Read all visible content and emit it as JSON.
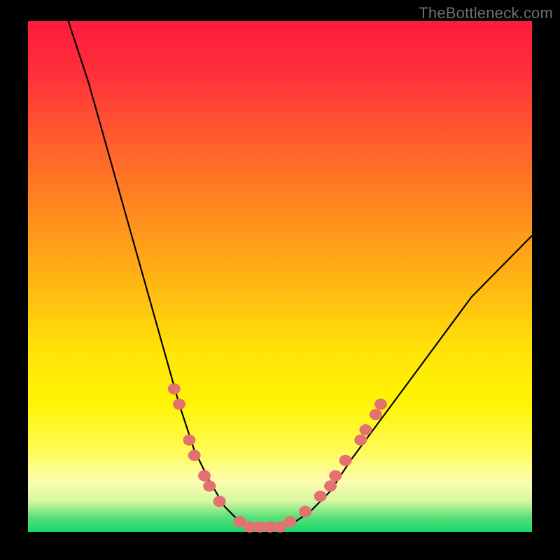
{
  "watermark": "TheBottleneck.com",
  "colors": {
    "background": "#000000",
    "curve": "#000000",
    "marker_fill": "#e4716f",
    "marker_stroke": "#c9574f"
  },
  "chart_data": {
    "type": "line",
    "title": "",
    "xlabel": "",
    "ylabel": "",
    "xlim": [
      0,
      100
    ],
    "ylim": [
      0,
      100
    ],
    "grid": false,
    "legend": false,
    "note": "No axis ticks or numeric labels are shown; values estimated from pixel positions on a 0–100 normalized grid.",
    "series": [
      {
        "name": "bottleneck-curve",
        "x": [
          8,
          12,
          16,
          20,
          24,
          28,
          30,
          33,
          36,
          39,
          42,
          45,
          48,
          50,
          53,
          56,
          60,
          64,
          70,
          76,
          82,
          88,
          94,
          100
        ],
        "y": [
          100,
          88,
          74,
          60,
          46,
          32,
          25,
          16,
          10,
          5,
          2,
          1,
          1,
          1,
          2,
          4,
          8,
          14,
          22,
          30,
          38,
          46,
          52,
          58
        ]
      }
    ],
    "markers": [
      {
        "x": 29,
        "y": 28
      },
      {
        "x": 30,
        "y": 25
      },
      {
        "x": 32,
        "y": 18
      },
      {
        "x": 33,
        "y": 15
      },
      {
        "x": 35,
        "y": 11
      },
      {
        "x": 36,
        "y": 9
      },
      {
        "x": 38,
        "y": 6
      },
      {
        "x": 42,
        "y": 2
      },
      {
        "x": 44,
        "y": 1
      },
      {
        "x": 46,
        "y": 1
      },
      {
        "x": 48,
        "y": 1
      },
      {
        "x": 50,
        "y": 1
      },
      {
        "x": 52,
        "y": 2
      },
      {
        "x": 55,
        "y": 4
      },
      {
        "x": 58,
        "y": 7
      },
      {
        "x": 60,
        "y": 9
      },
      {
        "x": 61,
        "y": 11
      },
      {
        "x": 63,
        "y": 14
      },
      {
        "x": 66,
        "y": 18
      },
      {
        "x": 67,
        "y": 20
      },
      {
        "x": 69,
        "y": 23
      },
      {
        "x": 70,
        "y": 25
      }
    ]
  }
}
